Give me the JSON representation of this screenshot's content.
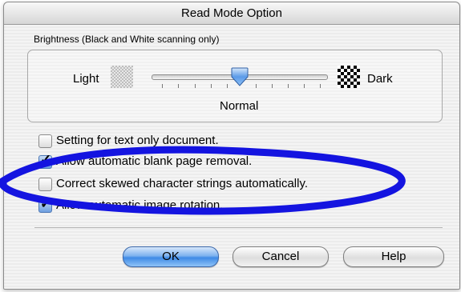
{
  "window": {
    "title": "Read Mode Option"
  },
  "brightness": {
    "group_label": "Brightness (Black and White scanning only)",
    "left_label": "Light",
    "right_label": "Dark",
    "value_label": "Normal",
    "slider_position": 0.5,
    "light_swatch_icon": "light-pattern-swatch",
    "dark_swatch_icon": "dark-pattern-swatch"
  },
  "options": [
    {
      "label": "Setting for text only document.",
      "checked": false
    },
    {
      "label": "Allow automatic blank page removal.",
      "checked": true
    },
    {
      "label": "Correct skewed character strings automatically.",
      "checked": false
    },
    {
      "label": "Allow automatic image rotation.",
      "checked": true
    }
  ],
  "buttons": {
    "ok": "OK",
    "cancel": "Cancel",
    "help": "Help"
  },
  "colors": {
    "accent": "#3f8ae6",
    "annotation": "#1414e0"
  }
}
